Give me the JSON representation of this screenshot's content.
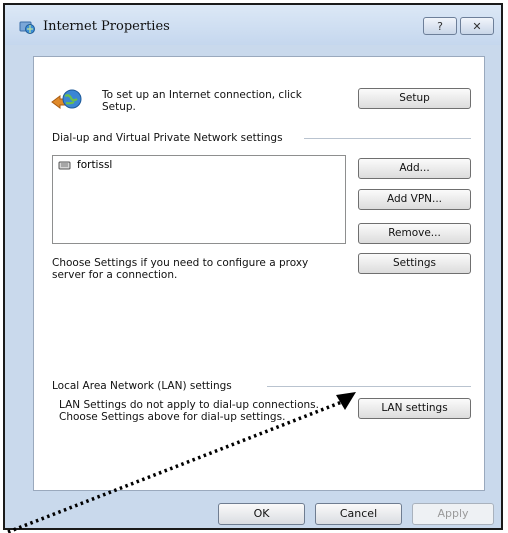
{
  "window": {
    "title": "Internet Properties",
    "help_label": "?",
    "close_label": "✕"
  },
  "setup": {
    "text_line1": "To set up an Internet connection, click",
    "text_line2": "Setup.",
    "button": "Setup"
  },
  "dialup": {
    "group_label": "Dial-up and Virtual Private Network settings",
    "connections": [
      "fortissl"
    ],
    "add": "Add...",
    "add_vpn": "Add VPN...",
    "remove": "Remove...",
    "proxy_line1": "Choose Settings if you need to configure a proxy",
    "proxy_line2": "server for a connection.",
    "settings": "Settings"
  },
  "lan": {
    "group_label": "Local Area Network (LAN) settings",
    "text_line1": "LAN Settings do not apply to dial-up connections.",
    "text_line2": "Choose Settings above for dial-up settings.",
    "button": "LAN settings"
  },
  "footer": {
    "ok": "OK",
    "cancel": "Cancel",
    "apply": "Apply"
  },
  "colors": {
    "frame": "#c9d9ec",
    "annotation_arrow": "#000000"
  }
}
